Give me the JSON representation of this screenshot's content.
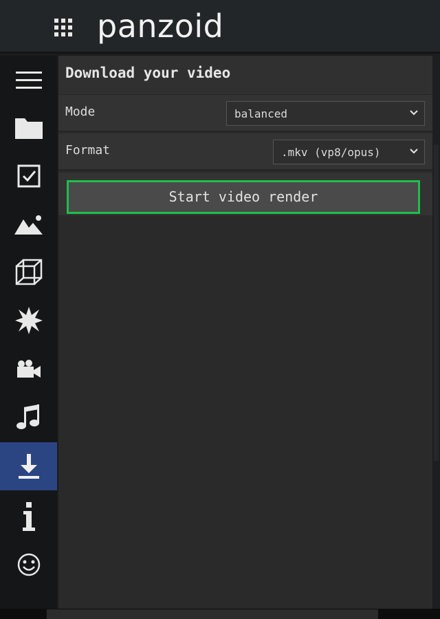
{
  "header": {
    "brand": "panzoid",
    "apps_icon": "apps-grid-icon"
  },
  "sidebar": {
    "items": [
      {
        "icon": "menu-icon",
        "active": false
      },
      {
        "icon": "folder-icon",
        "active": false
      },
      {
        "icon": "checkbox-icon",
        "active": false
      },
      {
        "icon": "image-icon",
        "active": false
      },
      {
        "icon": "cube-icon",
        "active": false
      },
      {
        "icon": "burst-icon",
        "active": false
      },
      {
        "icon": "video-camera-icon",
        "active": false
      },
      {
        "icon": "music-icon",
        "active": false
      },
      {
        "icon": "download-icon",
        "active": true
      },
      {
        "icon": "info-icon",
        "active": false
      },
      {
        "icon": "smiley-icon",
        "active": false
      }
    ]
  },
  "panel": {
    "title": "Download your video",
    "mode": {
      "label": "Mode",
      "value": "balanced"
    },
    "format": {
      "label": "Format",
      "value": ".mkv (vp8/opus)"
    },
    "render_button": "Start video render"
  },
  "colors": {
    "active_nav": "#2b4582",
    "button_outline": "#1fbf4b",
    "panel_bg": "#2a2a2a"
  }
}
